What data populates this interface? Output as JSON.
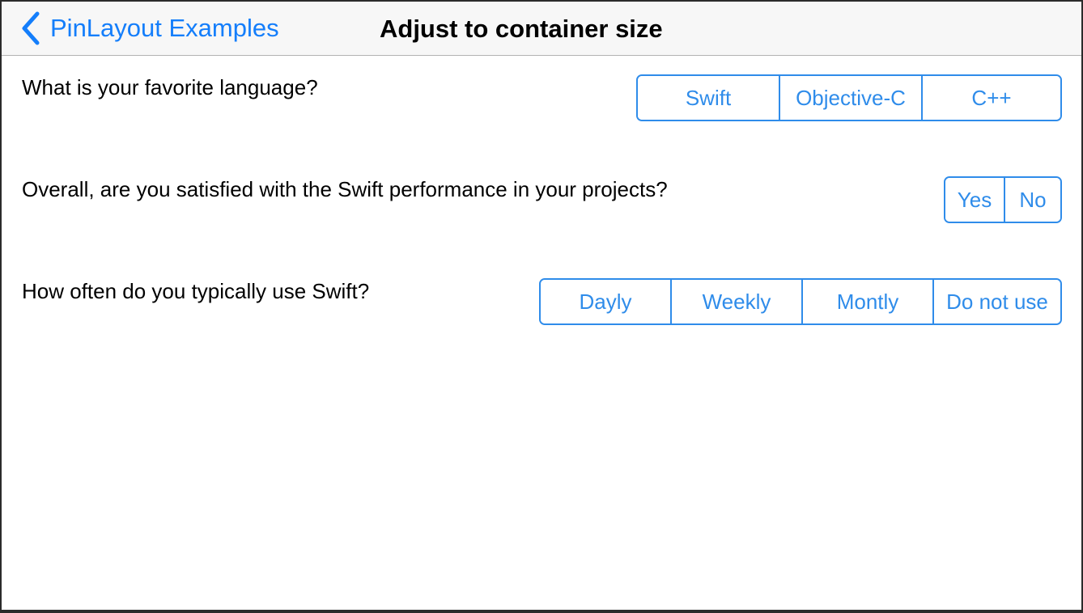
{
  "navbar": {
    "back_label": "PinLayout Examples",
    "title": "Adjust to container size"
  },
  "questions": [
    {
      "text": "What is your favorite language?",
      "options": [
        "Swift",
        "Objective-C",
        "C++"
      ]
    },
    {
      "text": "Overall, are you satisfied with the Swift performance in your projects?",
      "options": [
        "Yes",
        "No"
      ]
    },
    {
      "text": "How often do you typically use Swift?",
      "options": [
        "Dayly",
        "Weekly",
        "Montly",
        "Do not use"
      ]
    }
  ],
  "colors": {
    "accent": "#2f8cea",
    "nav_tint": "#147efb",
    "navbar_bg": "#f7f7f7"
  },
  "icons": {
    "back": "chevron-left-icon"
  }
}
